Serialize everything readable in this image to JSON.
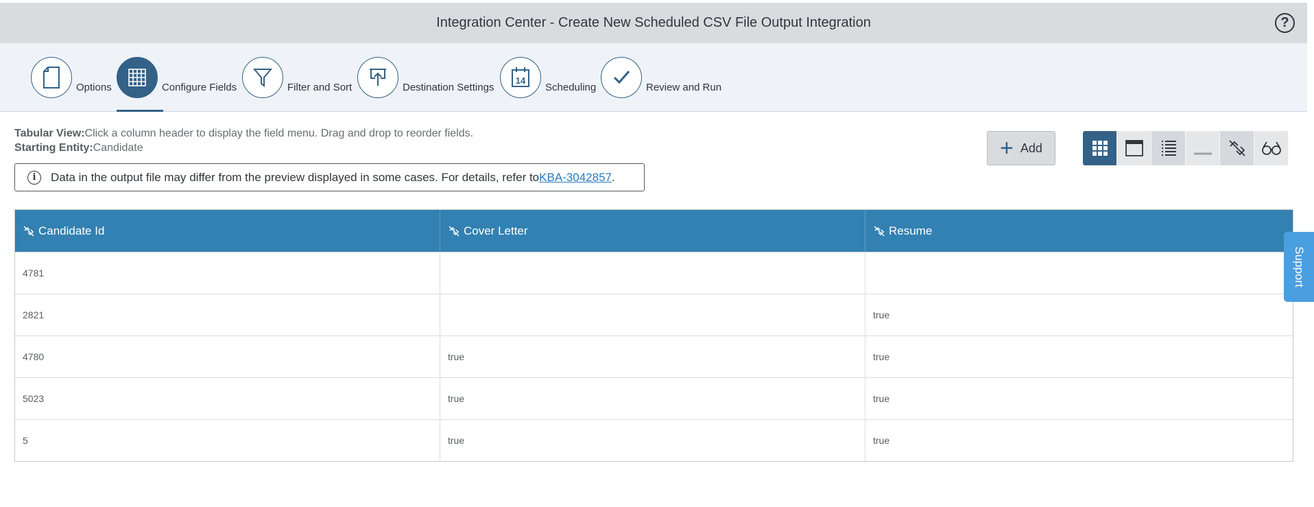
{
  "header": {
    "title": "Integration Center - Create New Scheduled CSV File Output Integration",
    "help_icon": "help-circle-icon"
  },
  "steps": [
    {
      "label": "Options",
      "icon": "document-icon",
      "active": false
    },
    {
      "label": "Configure Fields",
      "icon": "grid-icon",
      "active": true
    },
    {
      "label": "Filter and Sort",
      "icon": "funnel-icon",
      "active": false
    },
    {
      "label": "Destination Settings",
      "icon": "upload-icon",
      "active": false
    },
    {
      "label": "Scheduling",
      "icon": "calendar-icon",
      "active": false
    },
    {
      "label": "Review and Run",
      "icon": "checkmark-icon",
      "active": false
    }
  ],
  "calendar_day": "14",
  "info": {
    "view_label": "Tabular View:",
    "view_text": "Click a column header to display the field menu. Drag and drop to reorder fields.",
    "entity_label": "Starting Entity:",
    "entity_text": "Candidate"
  },
  "notice": {
    "text": "Data in the output file may differ from the preview displayed in some cases. For details, refer to ",
    "link": "KBA-3042857",
    "suffix": "."
  },
  "toolbar": {
    "add_label": "Add"
  },
  "table": {
    "columns": [
      "Candidate Id",
      "Cover Letter",
      "Resume"
    ],
    "rows": [
      [
        "4781",
        "",
        ""
      ],
      [
        "2821",
        "",
        "true"
      ],
      [
        "4780",
        "true",
        "true"
      ],
      [
        "5023",
        "true",
        "true"
      ],
      [
        "5",
        "true",
        "true"
      ]
    ]
  },
  "support": {
    "label": "Support"
  },
  "colors": {
    "accent": "#346187",
    "table_header": "#3281b2",
    "support": "#4a9fe0"
  }
}
